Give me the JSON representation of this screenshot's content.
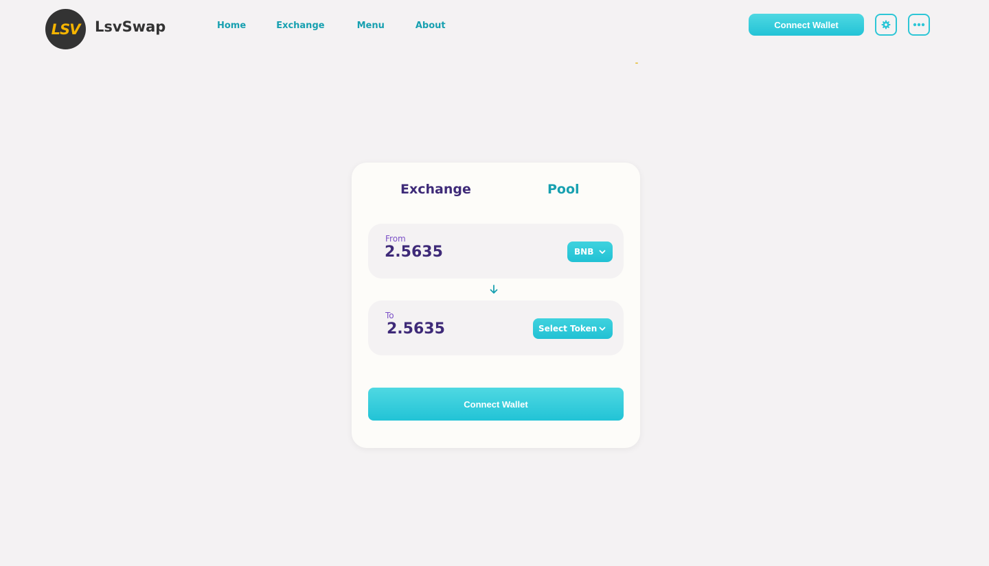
{
  "app": {
    "logo_text": "LSV",
    "brand_name": "LsvSwap"
  },
  "nav": {
    "items": [
      {
        "label": "Home"
      },
      {
        "label": "Exchange"
      },
      {
        "label": "Menu"
      },
      {
        "label": "About"
      }
    ]
  },
  "header": {
    "connect_wallet_label": "Connect Wallet",
    "settings_icon": "gear-icon",
    "more_icon": "more-dots-icon"
  },
  "card": {
    "tabs": [
      {
        "label": "Exchange",
        "active": true
      },
      {
        "label": "Pool",
        "active": false
      }
    ],
    "from": {
      "label": "From",
      "value": "2.5635",
      "token_label": "BNB"
    },
    "to": {
      "label": "To",
      "value": "2.5635",
      "token_label": "Select Token"
    },
    "swap_direction_icon": "arrow-down-icon",
    "connect_wallet_label": "Connect Wallet"
  },
  "colors": {
    "background": "#f4f2f3",
    "accent": "#23c3d6",
    "nav_text": "#17a0b0",
    "primary_text": "#3e2a78",
    "label_text": "#7a4fc7",
    "logo_bg": "#333333",
    "logo_text": "#f5b400"
  }
}
